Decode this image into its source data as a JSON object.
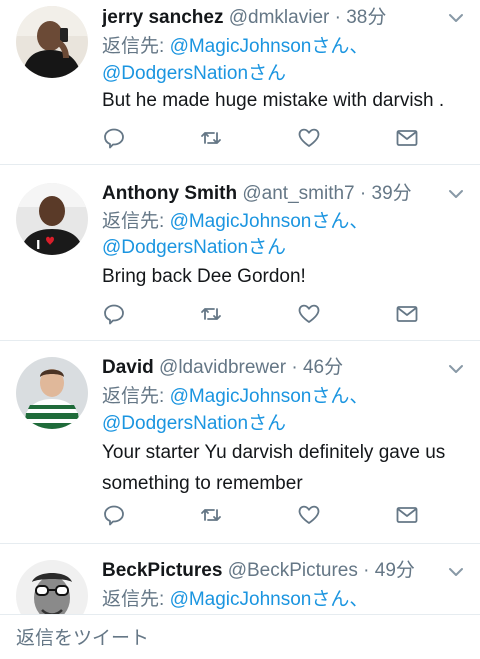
{
  "tweets": [
    {
      "name": "jerry sanchez",
      "handle": "@dmklavier",
      "separator": "·",
      "time": "38分",
      "reply_prefix": "返信先: ",
      "mentions": [
        "@MagicJohnson",
        "@DodgersNation"
      ],
      "mention_suffix": "さん",
      "mention_comma": "、",
      "text": "But he made huge mistake with darvish ."
    },
    {
      "name": "Anthony Smith",
      "handle": "@ant_smith7",
      "separator": "·",
      "time": "39分",
      "reply_prefix": "返信先: ",
      "mentions": [
        "@MagicJohnson",
        "@DodgersNation"
      ],
      "mention_suffix": "さん",
      "mention_comma": "、",
      "text": "Bring back Dee Gordon!"
    },
    {
      "name": "David",
      "handle": "@ldavidbrewer",
      "separator": "·",
      "time": "46分",
      "reply_prefix": "返信先: ",
      "mentions": [
        "@MagicJohnson",
        "@DodgersNation"
      ],
      "mention_suffix": "さん",
      "mention_comma": "、",
      "text": "Your starter Yu darvish definitely gave us something to remember"
    },
    {
      "name": "BeckPictures",
      "handle": "@BeckPictures",
      "separator": "·",
      "time": "49分",
      "reply_prefix": "返信先: ",
      "mentions": [
        "@MagicJohnson"
      ],
      "mention_suffix": "さん",
      "mention_comma": "、",
      "text": ""
    }
  ],
  "compose": {
    "placeholder": "返信をツイート"
  },
  "icons": {
    "reply": "reply-icon",
    "retweet": "retweet-icon",
    "like": "heart-icon",
    "dm": "envelope-icon",
    "menu": "chevron-down-icon"
  },
  "colors": {
    "link": "#1b95e0",
    "secondary": "#657786",
    "text": "#14171a",
    "divider": "#e6ecf0"
  }
}
